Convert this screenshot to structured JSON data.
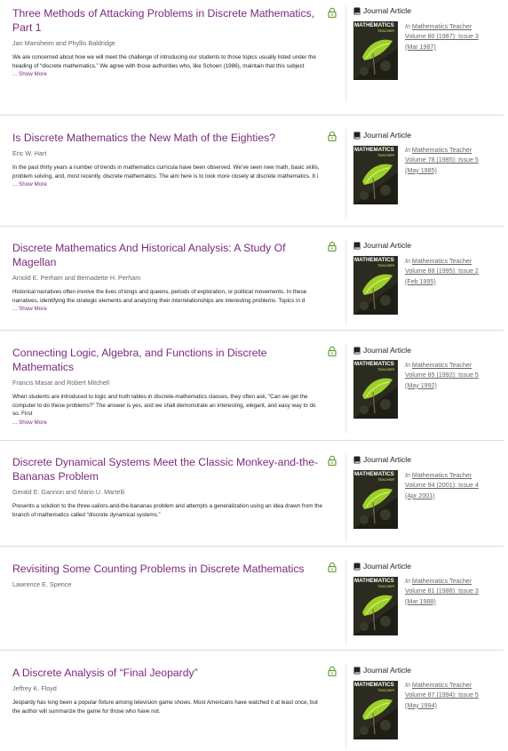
{
  "type_label": "Journal Article",
  "in_label": "In",
  "journal": "Mathematics Teacher",
  "more_label": "... Show More",
  "cover": {
    "title": "MATHEMATICS",
    "subtitle": "TEACHER",
    "colors": {
      "dark": "#2b2b20",
      "leaf": "#9ccf2a",
      "leaf_light": "#d7ee6a"
    }
  },
  "colors": {
    "title": "#7a2a7d",
    "lock": "#6a9e3a",
    "border": "#dddddd"
  },
  "results": [
    {
      "title": "Three Methods of Attacking Problems in Discrete Mathematics, Part 1",
      "authors": "Jan Mansheim and Phyllis Baldridge",
      "abstract": "We are concerned about how we will meet the challenge of introducing our students to those topics usually listed under the heading of “discrete mathematics.” We agree with those authorities who, like Schoen (1986), maintain that this subject",
      "show_more": true,
      "volume_issue": "Volume 80 (1987): Issue 3",
      "date": "(Mar 1987)"
    },
    {
      "title": "Is Discrete Mathematics the New Math of the Eighties?",
      "authors": "Eric W. Hart",
      "abstract": "In the past thirty years a number of trends in mathematics curricula have been observed. We’ve seen new math, basic skills, problem solving, and, most recently, discrete mathematics. The aim here is to look more closely at discrete mathematics. It i",
      "show_more": true,
      "volume_issue": "Volume 78 (1985): Issue 5",
      "date": "(May 1985)"
    },
    {
      "title": "Discrete Mathematics And Historical Analysis: A Study Of Magellan",
      "authors": "Arnold E. Perham and Bernadette H. Perham",
      "abstract": "Historical narratives often involve the lives of kings and queens, periods of exploration, or political movements. In these narratives, identifying the strategic elements and analyzing their interrelationships are interesting problems. Topics in d",
      "show_more": true,
      "volume_issue": "Volume 88 (1995): Issue 2",
      "date": "(Feb 1995)"
    },
    {
      "title": "Connecting Logic, Algebra, and Functions in Discrete Mathematics",
      "authors": "Francis Masat and Robert Mitchell",
      "abstract": "When students are introduced to logic and truth tables in discrete-mathematics classes, they often ask, “Can we get the computer to do these problems?” The answer is yes, and we shall demonstrate an interesting, elegant, and easy way to do so. First",
      "show_more": true,
      "volume_issue": "Volume 85 (1992): Issue 5",
      "date": "(May 1992)"
    },
    {
      "title": "Discrete Dynamical Systems Meet the Classic Monkey-and-the-Bananas Problem",
      "authors": "Gerald E. Gannon and Mario U. Martelli",
      "abstract": "Presents a solution to the three-sailors-and-the-bananas problem and attempts a generalization using an idea drawn from the branch of mathematics called “discrete dynamical systems.”",
      "show_more": false,
      "volume_issue": "Volume 94 (2001): Issue 4",
      "date": "(Apr 2001)"
    },
    {
      "title": "Revisiting Some Counting Problems in Discrete Mathematics",
      "authors": "Lawrence E. Spence",
      "abstract": "",
      "show_more": false,
      "volume_issue": "Volume 81 (1988): Issue 3",
      "date": "(Mar 1988)"
    },
    {
      "title": "A Discrete Analysis of “Final Jeopardy”",
      "authors": "Jeffrey K. Floyd",
      "abstract": "Jeopardy has long been a popular fixture among television game shows. Most Americans have watched it at least once, but the author will summarize the game for those who have not.",
      "show_more": false,
      "volume_issue": "Volume 87 (1994): Issue 5",
      "date": "(May 1994)"
    }
  ]
}
